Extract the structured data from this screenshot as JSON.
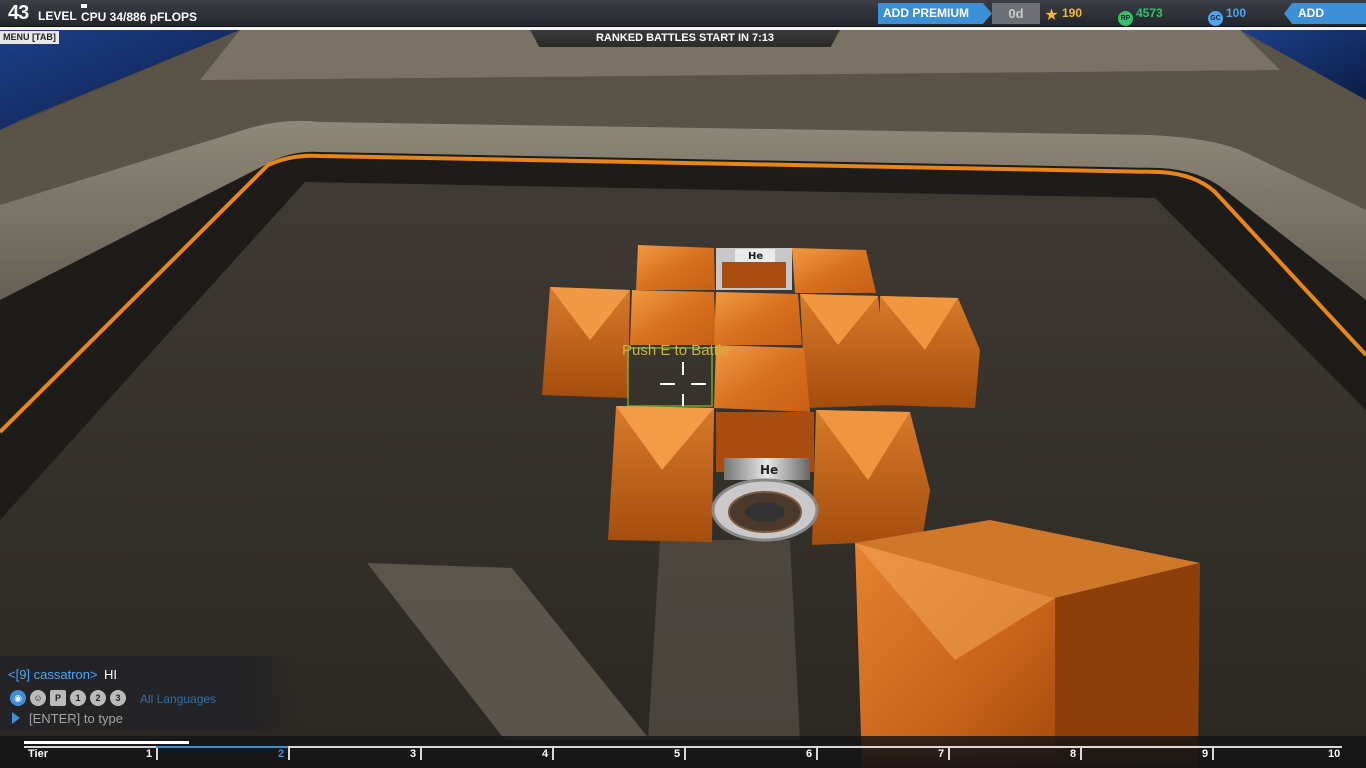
{
  "hud": {
    "level": "43",
    "level_label": "LEVEL",
    "cpu": "CPU 34/886 pFLOPS",
    "add_premium": "ADD PREMIUM",
    "premium_days": "0d",
    "robits_icon": "★",
    "robits": "190",
    "rp_icon": "RP",
    "rp": "4573",
    "gc_icon": "GC",
    "gc": "100",
    "add_funds": "ADD FUNDS",
    "menu": "MENU [TAB]",
    "ranked": "RANKED BATTLES START IN 7:13"
  },
  "prompt": "Push E to Battle",
  "chat": {
    "sender": "<[9] cassatron>",
    "message": "HI",
    "languages": "All Languages",
    "input_hint": "[ENTER] to type",
    "filter_icons": [
      "globe-icon",
      "person-icon",
      "p-icon",
      "party-1-icon",
      "party-2-icon",
      "party-3-icon"
    ]
  },
  "tiers": {
    "label": "Tier",
    "values": [
      "1",
      "2",
      "3",
      "4",
      "5",
      "6",
      "7",
      "8",
      "9",
      "10"
    ],
    "current": "2",
    "progress": 0.55
  },
  "colors": {
    "accent_blue": "#3d8fd6",
    "cube_orange": "#e8822a",
    "prompt_yellow": "#c9b544",
    "rp_green": "#39c06a"
  }
}
